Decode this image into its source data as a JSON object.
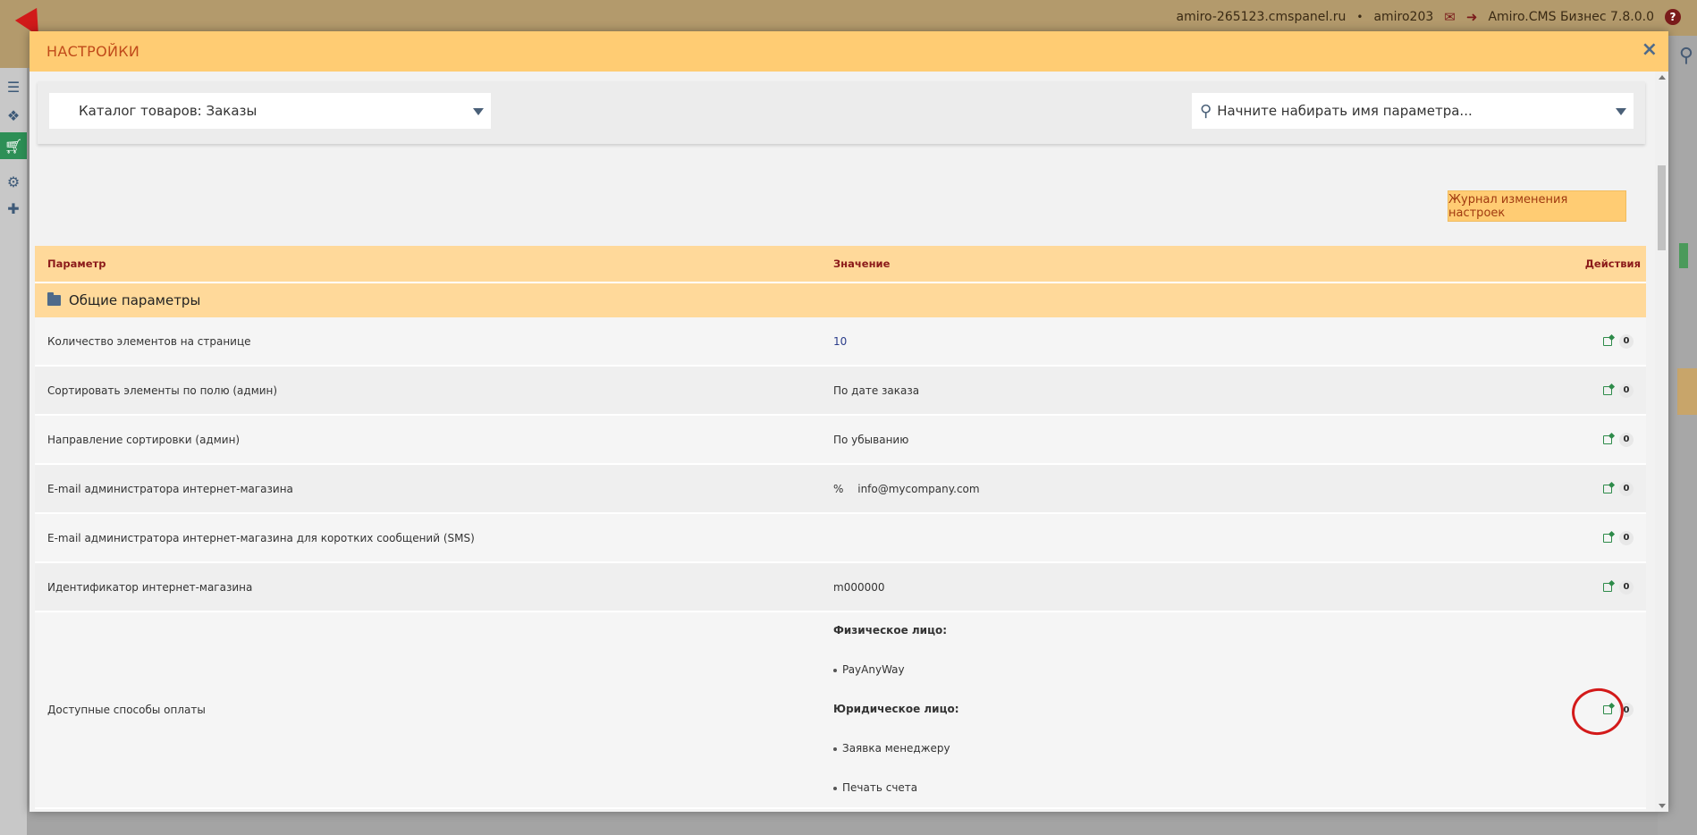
{
  "topbar": {
    "site": "amiro-265123.cmspanel.ru",
    "separator": "•",
    "user": "amiro203",
    "version": "Amiro.CMS Бизнес 7.8.0.0",
    "help": "?"
  },
  "modal": {
    "title": "НАСТРОЙКИ",
    "close": "×",
    "module_select": "Каталог товаров: Заказы",
    "param_search_placeholder": "Начните набирать имя параметра...",
    "log_button": "Журнал изменения настроек"
  },
  "table": {
    "headers": {
      "param": "Параметр",
      "value": "Значение",
      "actions": "Действия"
    },
    "group": "Общие параметры",
    "rows": [
      {
        "param": "Количество элементов на странице",
        "value": "10"
      },
      {
        "param": "Сортировать элементы по полю (админ)",
        "value": "По дате заказа"
      },
      {
        "param": "Направление сортировки (админ)",
        "value": "По убыванию"
      },
      {
        "param": "E-mail администратора интернет-магазина",
        "value": "info@mycompany.com"
      },
      {
        "param": "E-mail администратора интернет-магазина для коротких сообщений (SMS)",
        "value": ""
      },
      {
        "param": "Идентификатор интернет-магазина",
        "value": "m000000"
      },
      {
        "param": "Доступные способы оплаты",
        "value": ""
      }
    ],
    "payments": {
      "individual_label": "Физическое лицо:",
      "individual_items": [
        "PayAnyWay"
      ],
      "legal_label": "Юридическое лицо:",
      "legal_items": [
        "Заявка менеджеру",
        "Печать счета"
      ]
    },
    "reset_glyph": "0"
  },
  "icons": {
    "link": "%",
    "search": "magnifier-icon"
  },
  "colors": {
    "header_bg": "#ffcc73",
    "title_color": "#c04a1a",
    "table_header_bg": "#ffd99a",
    "highlight_circle": "#d31a1a"
  }
}
